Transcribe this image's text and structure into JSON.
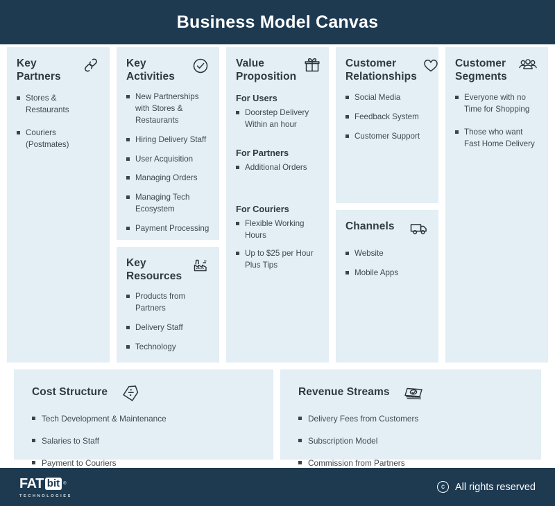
{
  "header": {
    "title": "Business Model Canvas"
  },
  "colors": {
    "header_bg": "#1d3a51",
    "card_bg": "#e3eef5",
    "page_bg": "#ffffff",
    "text": "#40494f",
    "title_text": "#2f3a40"
  },
  "cards": {
    "key_partners": {
      "title": "Key Partners",
      "icon": "link-icon",
      "items": [
        "Stores & Restaurants",
        "Couriers (Postmates)"
      ]
    },
    "key_activities": {
      "title": "Key Activities",
      "icon": "check-circle-icon",
      "items": [
        "New Partnerships with Stores & Restaurants",
        "Hiring Delivery Staff",
        "User Acquisition",
        "Managing Orders",
        "Managing Tech Ecosystem",
        "Payment Processing"
      ]
    },
    "key_resources": {
      "title": "Key Resources",
      "icon": "factory-icon",
      "items": [
        "Products from Partners",
        "Delivery Staff",
        "Technology"
      ]
    },
    "value_proposition": {
      "title": "Value Proposition",
      "icon": "gift-icon",
      "groups": [
        {
          "label": "For Users",
          "items": [
            "Doorstep Delivery Within an hour"
          ]
        },
        {
          "label": "For Partners",
          "items": [
            "Additional Orders"
          ]
        },
        {
          "label": "For Couriers",
          "items": [
            "Flexible Working Hours",
            "Up to $25 per Hour Plus Tips"
          ]
        }
      ]
    },
    "customer_relationships": {
      "title": "Customer Relationships",
      "icon": "heart-icon",
      "items": [
        "Social Media",
        "Feedback System",
        "Customer Support"
      ]
    },
    "channels": {
      "title": "Channels",
      "icon": "truck-icon",
      "items": [
        "Website",
        "Mobile Apps"
      ]
    },
    "customer_segments": {
      "title": "Customer Segments",
      "icon": "people-group-icon",
      "items": [
        "Everyone with no Time for Shopping",
        "Those who want Fast Home Delivery"
      ]
    },
    "cost_structure": {
      "title": "Cost Structure",
      "icon": "price-tag-icon",
      "items": [
        "Tech Development & Maintenance",
        "Salaries to Staff",
        "Payment to Couriers"
      ]
    },
    "revenue_streams": {
      "title": "Revenue  Streams",
      "icon": "money-icon",
      "items": [
        "Delivery Fees from Customers",
        "Subscription Model",
        "Commission from Partners"
      ]
    }
  },
  "footer": {
    "logo_main": "FAT",
    "logo_badge": "bit",
    "logo_sub": "TECHNOLOGIES",
    "copyright_mark": "c",
    "rights_text": "All rights reserved"
  }
}
